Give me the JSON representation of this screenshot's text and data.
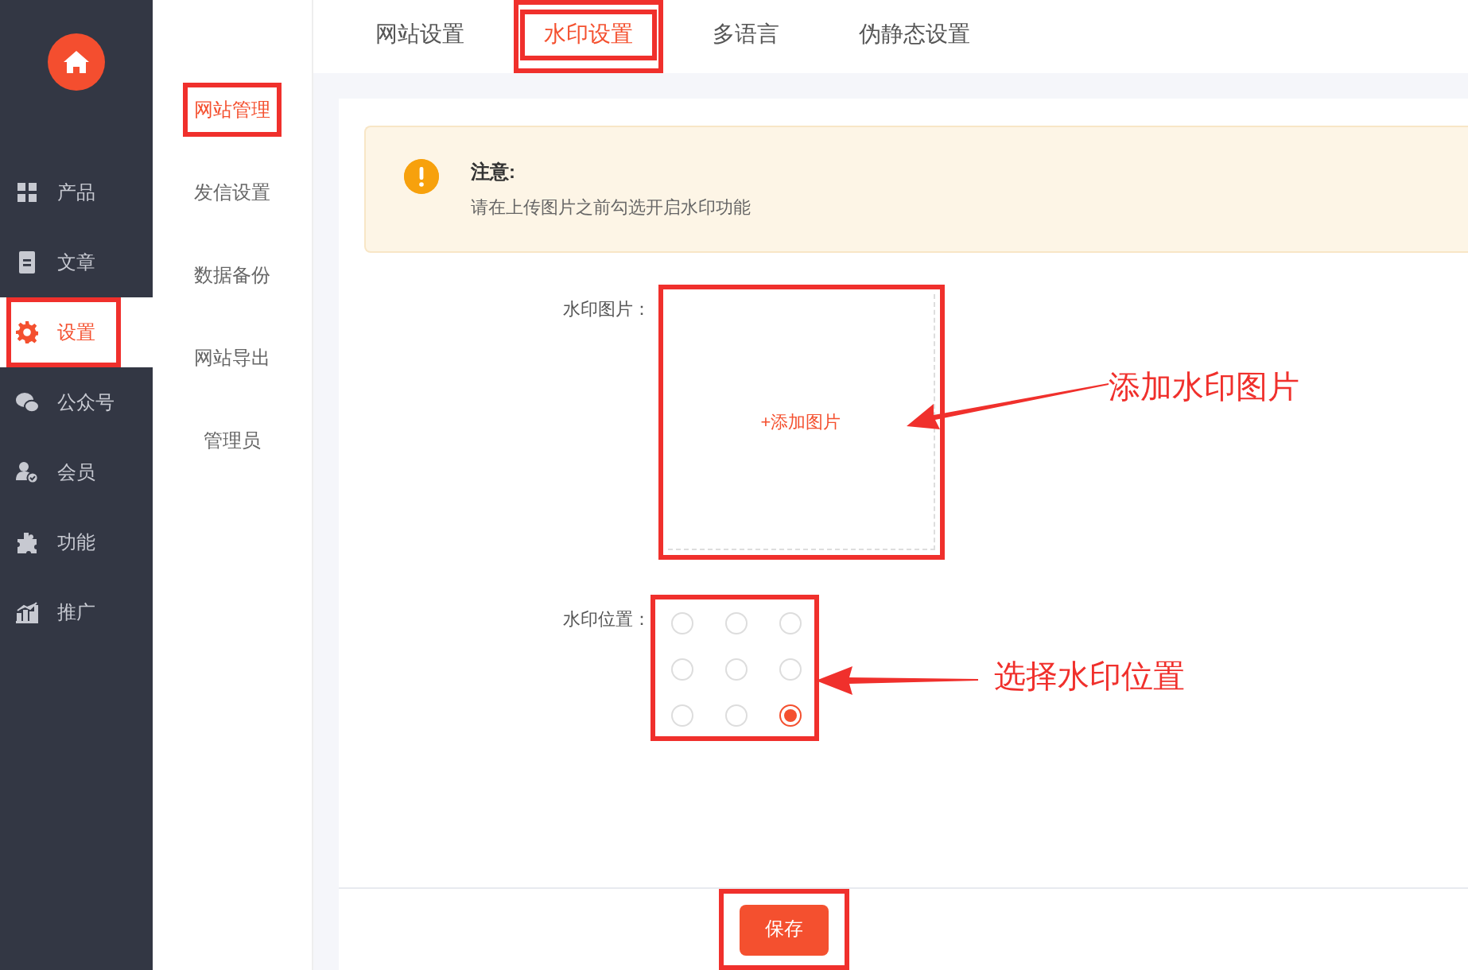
{
  "sidebar": {
    "items": [
      {
        "label": "产品",
        "selected": false,
        "annotated": false
      },
      {
        "label": "文章",
        "selected": false,
        "annotated": false
      },
      {
        "label": "设置",
        "selected": true,
        "annotated": true
      },
      {
        "label": "公众号",
        "selected": false,
        "annotated": false
      },
      {
        "label": "会员",
        "selected": false,
        "annotated": false
      },
      {
        "label": "功能",
        "selected": false,
        "annotated": false
      },
      {
        "label": "推广",
        "selected": false,
        "annotated": false
      }
    ]
  },
  "subnav": {
    "items": [
      {
        "label": "网站管理",
        "selected": true,
        "annotated": true
      },
      {
        "label": "发信设置",
        "selected": false,
        "annotated": false
      },
      {
        "label": "数据备份",
        "selected": false,
        "annotated": false
      },
      {
        "label": "网站导出",
        "selected": false,
        "annotated": false
      },
      {
        "label": "管理员",
        "selected": false,
        "annotated": false
      }
    ]
  },
  "tabs": [
    {
      "label": "网站设置",
      "selected": false,
      "annotated": false
    },
    {
      "label": "水印设置",
      "selected": true,
      "annotated": true
    },
    {
      "label": "多语言",
      "selected": false,
      "annotated": false
    },
    {
      "label": "伪静态设置",
      "selected": false,
      "annotated": false
    }
  ],
  "notice": {
    "title": "注意:",
    "text": "请在上传图片之前勾选开启水印功能"
  },
  "watermark_image": {
    "label": "水印图片：",
    "button": "+添加图片",
    "annotated": true
  },
  "watermark_position": {
    "label": "水印位置：",
    "annotated": true,
    "options": [
      {
        "selected": false
      },
      {
        "selected": false
      },
      {
        "selected": false
      },
      {
        "selected": false
      },
      {
        "selected": false
      },
      {
        "selected": false
      },
      {
        "selected": false
      },
      {
        "selected": false
      },
      {
        "selected": true
      }
    ]
  },
  "save_button": {
    "label": "保存",
    "annotated": true
  },
  "callouts": [
    {
      "text": "添加水印图片"
    },
    {
      "text": "选择水印位置"
    }
  ]
}
